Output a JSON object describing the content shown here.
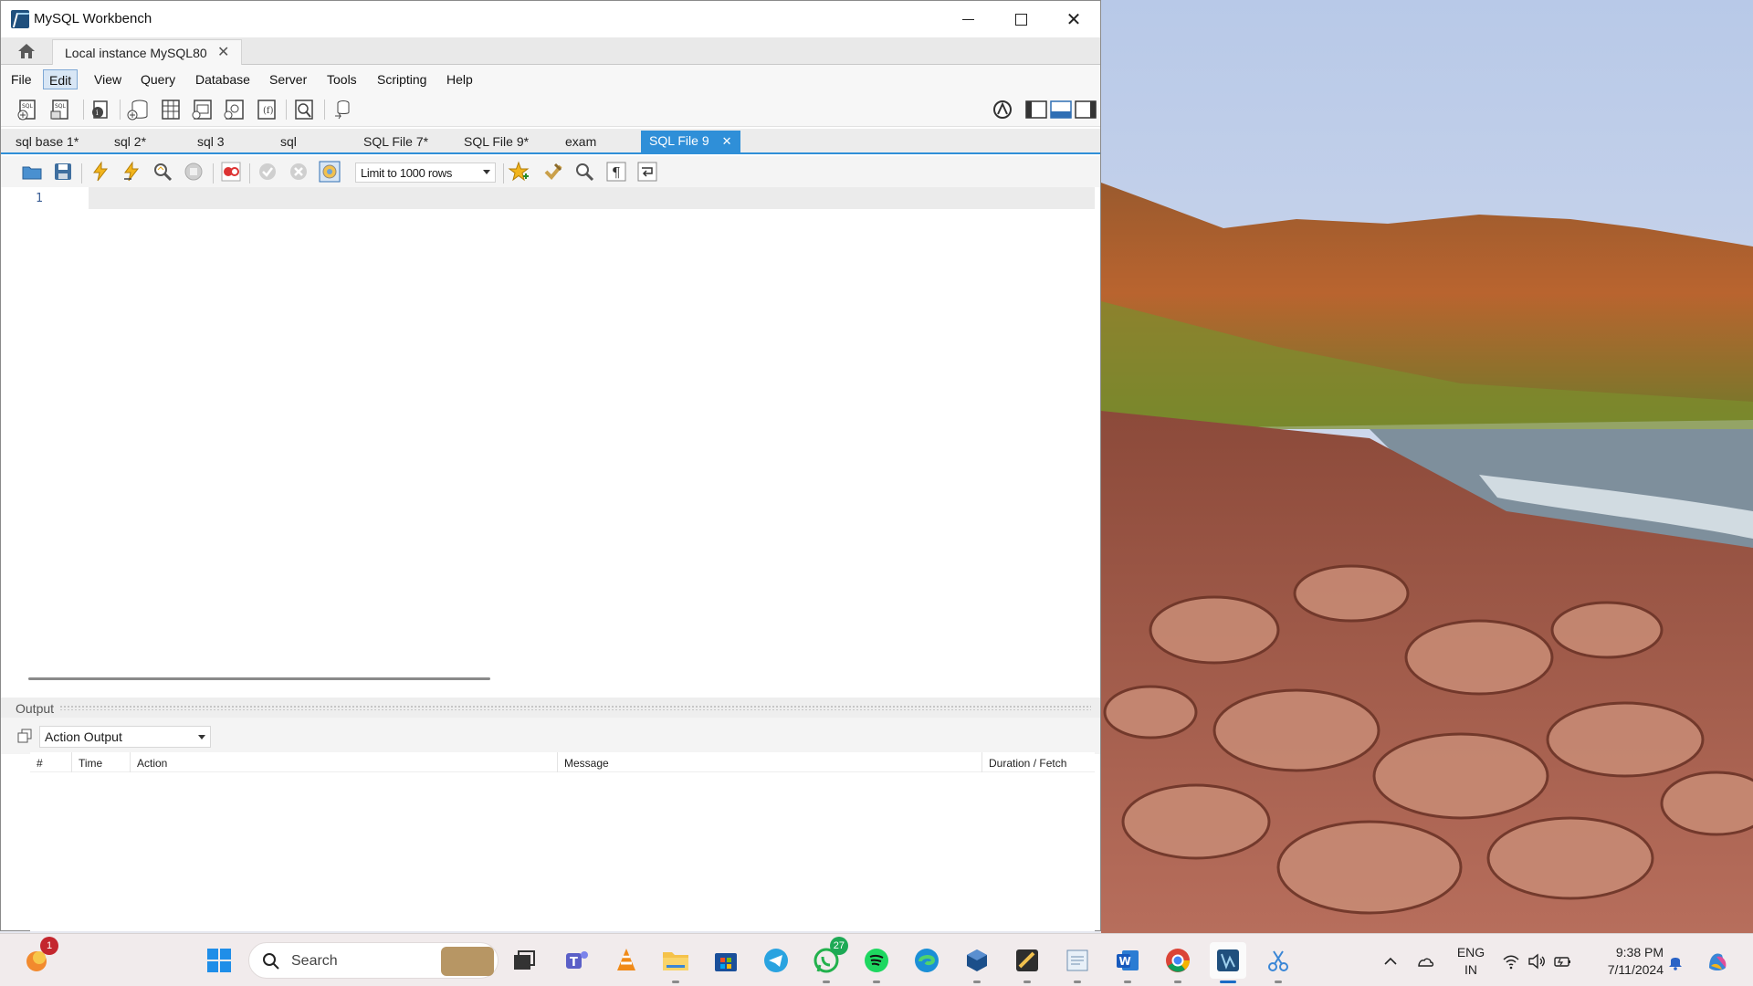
{
  "window": {
    "title": "MySQL Workbench"
  },
  "connection_tab": {
    "label": "Local instance MySQL80"
  },
  "menu": [
    "File",
    "Edit",
    "View",
    "Query",
    "Database",
    "Server",
    "Tools",
    "Scripting",
    "Help"
  ],
  "menu_active": "Edit",
  "editor_tabs": [
    {
      "label": "sql base 1*",
      "active": false
    },
    {
      "label": "sql 2*",
      "active": false
    },
    {
      "label": "sql 3",
      "active": false
    },
    {
      "label": "sql",
      "active": false
    },
    {
      "label": "SQL File 7*",
      "active": false
    },
    {
      "label": "SQL File 9*",
      "active": false
    },
    {
      "label": "exam",
      "active": false
    },
    {
      "label": "SQL File 9",
      "active": true
    }
  ],
  "query_toolbar": {
    "limit_value": "Limit to 1000 rows"
  },
  "editor": {
    "line_number": "1",
    "content": ""
  },
  "output": {
    "title": "Output",
    "mode": "Action Output",
    "columns": [
      "#",
      "Time",
      "Action",
      "Message",
      "Duration / Fetch"
    ]
  },
  "taskbar": {
    "search_label": "Search",
    "apps": [
      {
        "name": "widgets",
        "badge": "1"
      },
      {
        "name": "start-windows"
      },
      {
        "name": "task-view"
      },
      {
        "name": "teams"
      },
      {
        "name": "vlc"
      },
      {
        "name": "file-explorer"
      },
      {
        "name": "microsoft-store"
      },
      {
        "name": "telegram"
      },
      {
        "name": "whatsapp",
        "badge": "27"
      },
      {
        "name": "spotify"
      },
      {
        "name": "edge"
      },
      {
        "name": "virtualbox"
      },
      {
        "name": "sketch-tool"
      },
      {
        "name": "notepad-app"
      },
      {
        "name": "word"
      },
      {
        "name": "chrome"
      },
      {
        "name": "mysql-workbench"
      },
      {
        "name": "snipping-tool"
      }
    ],
    "tray": {
      "lang_top": "ENG",
      "lang_bottom": "IN",
      "time": "9:38 PM",
      "date": "7/11/2024"
    }
  },
  "colors": {
    "accent": "#2f8fd8",
    "window_bg": "#ffffff",
    "taskbar_bg": "#f1ebec",
    "active_menu": "#d8e6f5"
  }
}
